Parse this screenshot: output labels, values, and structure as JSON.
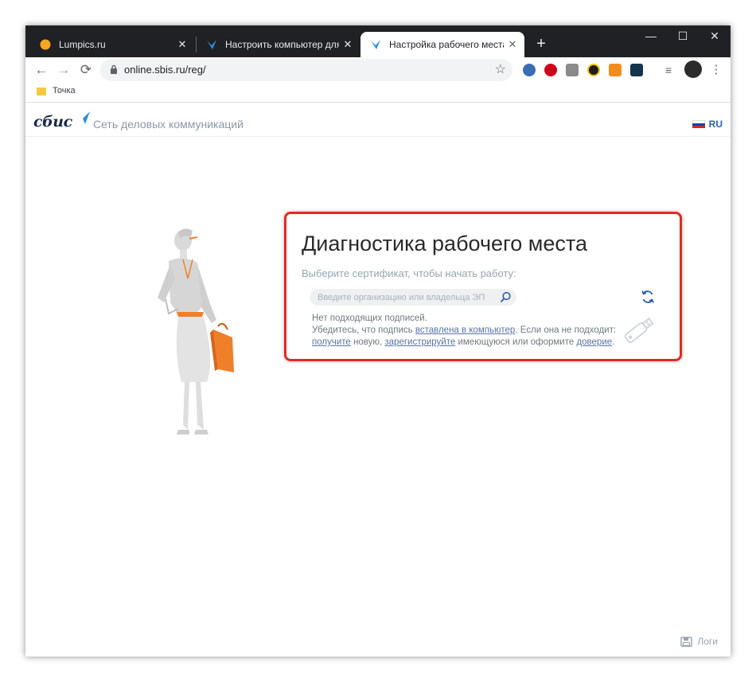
{
  "browser": {
    "tabs": [
      {
        "title": "Lumpics.ru",
        "active": false
      },
      {
        "title": "Настроить компьютер для рабо",
        "active": false
      },
      {
        "title": "Настройка рабочего места",
        "active": true
      }
    ],
    "url": "online.sbis.ru/reg/",
    "bookmark": "Точка"
  },
  "header": {
    "logo": "сбис",
    "tagline": "Сеть деловых коммуникаций",
    "lang": "RU"
  },
  "diagnostics": {
    "title": "Диагностика рабочего места",
    "subtitle": "Выберите сертификат, чтобы начать работу:",
    "search_placeholder": "Введите организацию или владельца ЭП",
    "no_signatures": "Нет подходящих подписей.",
    "line2_prefix": "Убедитесь, что подпись",
    "link_inserted": "вставлена в компьютер",
    "line2_suffix": ". Если она не подходит:",
    "link_get": "получите",
    "line3_part1": "новую,",
    "link_register": "зарегистрируйте",
    "line3_part2": "имеющуюся или оформите",
    "link_trust": "доверие",
    "line3_end": "."
  },
  "footer": {
    "logs": "Логи"
  },
  "colors": {
    "accent_red": "#e02b27",
    "brand_blue": "#2b5fb0",
    "orange": "#f07f2a"
  }
}
